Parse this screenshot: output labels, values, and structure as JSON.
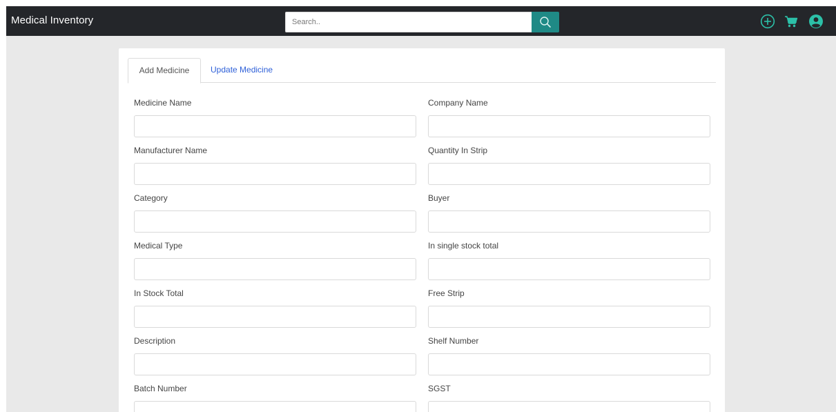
{
  "app": {
    "title": "Medical Inventory"
  },
  "search": {
    "placeholder": "Search.."
  },
  "nav_icons": [
    "plus-circle-icon",
    "cart-icon",
    "user-circle-icon"
  ],
  "colors": {
    "navbar": "#24262a",
    "search_button": "#1f8a86",
    "tab_link": "#2d5fd8",
    "background": "#e9e9e9"
  },
  "tabs": [
    {
      "label": "Add Medicine",
      "active": true
    },
    {
      "label": "Update Medicine",
      "active": false
    }
  ],
  "form": {
    "fields": [
      {
        "label": "Medicine Name",
        "value": ""
      },
      {
        "label": "Company Name",
        "value": ""
      },
      {
        "label": "Manufacturer Name",
        "value": ""
      },
      {
        "label": "Quantity In Strip",
        "value": ""
      },
      {
        "label": "Category",
        "value": ""
      },
      {
        "label": "Buyer",
        "value": ""
      },
      {
        "label": "Medical Type",
        "value": ""
      },
      {
        "label": "In single stock total",
        "value": ""
      },
      {
        "label": "In Stock Total",
        "value": ""
      },
      {
        "label": "Free Strip",
        "value": ""
      },
      {
        "label": "Description",
        "value": ""
      },
      {
        "label": "Shelf Number",
        "value": ""
      },
      {
        "label": "Batch Number",
        "value": ""
      },
      {
        "label": "SGST",
        "value": ""
      }
    ]
  }
}
